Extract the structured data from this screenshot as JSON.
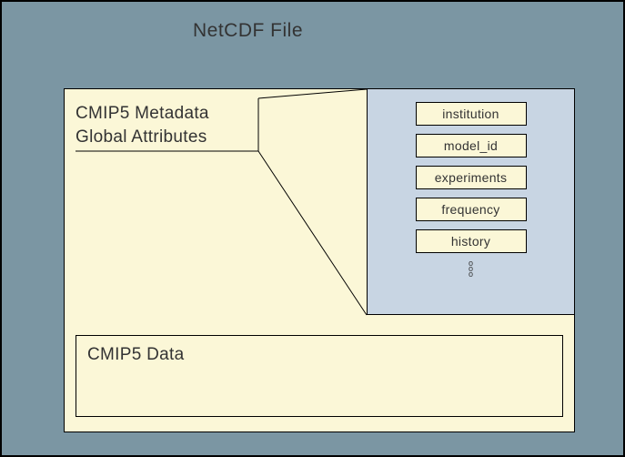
{
  "title": "NetCDF File",
  "metadata_label_line1": "CMIP5 Metadata",
  "metadata_label_line2": "Global Attributes",
  "attributes": {
    "a0": "institution",
    "a1": "model_id",
    "a2": "experiments",
    "a3": "frequency",
    "a4": "history"
  },
  "data_label": "CMIP5 Data"
}
